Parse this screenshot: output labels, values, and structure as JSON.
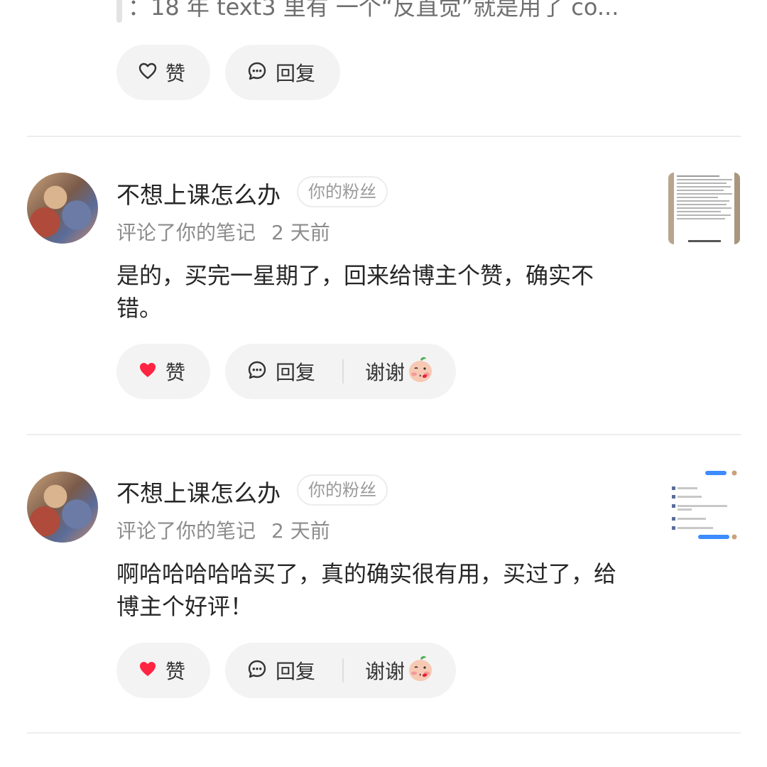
{
  "top_comment": {
    "quote_text": "：18 年 text3 里有 一个“反直觉”就是用了 co...",
    "like_label": "赞",
    "reply_label": "回复"
  },
  "comments": [
    {
      "author": "不想上课怎么办",
      "badge": "你的粉丝",
      "action": "评论了你的笔记",
      "time": "2 天前",
      "text": "是的，买完一星期了，回来给博主个赞，确实不错。",
      "like_label": "赞",
      "liked": true,
      "reply_label": "回复",
      "thanks_label": "谢谢"
    },
    {
      "author": "不想上课怎么办",
      "badge": "你的粉丝",
      "action": "评论了你的笔记",
      "time": "2 天前",
      "text": "啊哈哈哈哈哈买了，真的确实很有用，买过了，给博主个好评！",
      "like_label": "赞",
      "liked": true,
      "reply_label": "回复",
      "thanks_label": "谢谢"
    }
  ],
  "colors": {
    "like_active": "#ff2442",
    "pill_bg": "#f3f3f3",
    "separator": "#ededed"
  }
}
